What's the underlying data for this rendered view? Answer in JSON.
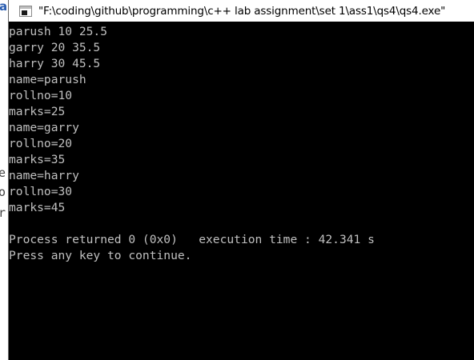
{
  "background_window": {
    "glyphs": [
      "a",
      "e",
      "o",
      "r"
    ]
  },
  "window": {
    "title": "\"F:\\coding\\github\\programming\\c++ lab assignment\\set 1\\ass1\\qs4\\qs4.exe\"",
    "icon": "console-app-icon"
  },
  "console": {
    "lines": [
      "parush 10 25.5",
      "garry 20 35.5",
      "harry 30 45.5",
      "name=parush",
      "rollno=10",
      "marks=25",
      "name=garry",
      "rollno=20",
      "marks=35",
      "name=harry",
      "rollno=30",
      "marks=45",
      "",
      "Process returned 0 (0x0)   execution time : 42.341 s",
      "Press any key to continue."
    ]
  },
  "colors": {
    "console_background": "#000000",
    "console_text": "#c0c0c0",
    "title_bar": "#ffffff"
  }
}
